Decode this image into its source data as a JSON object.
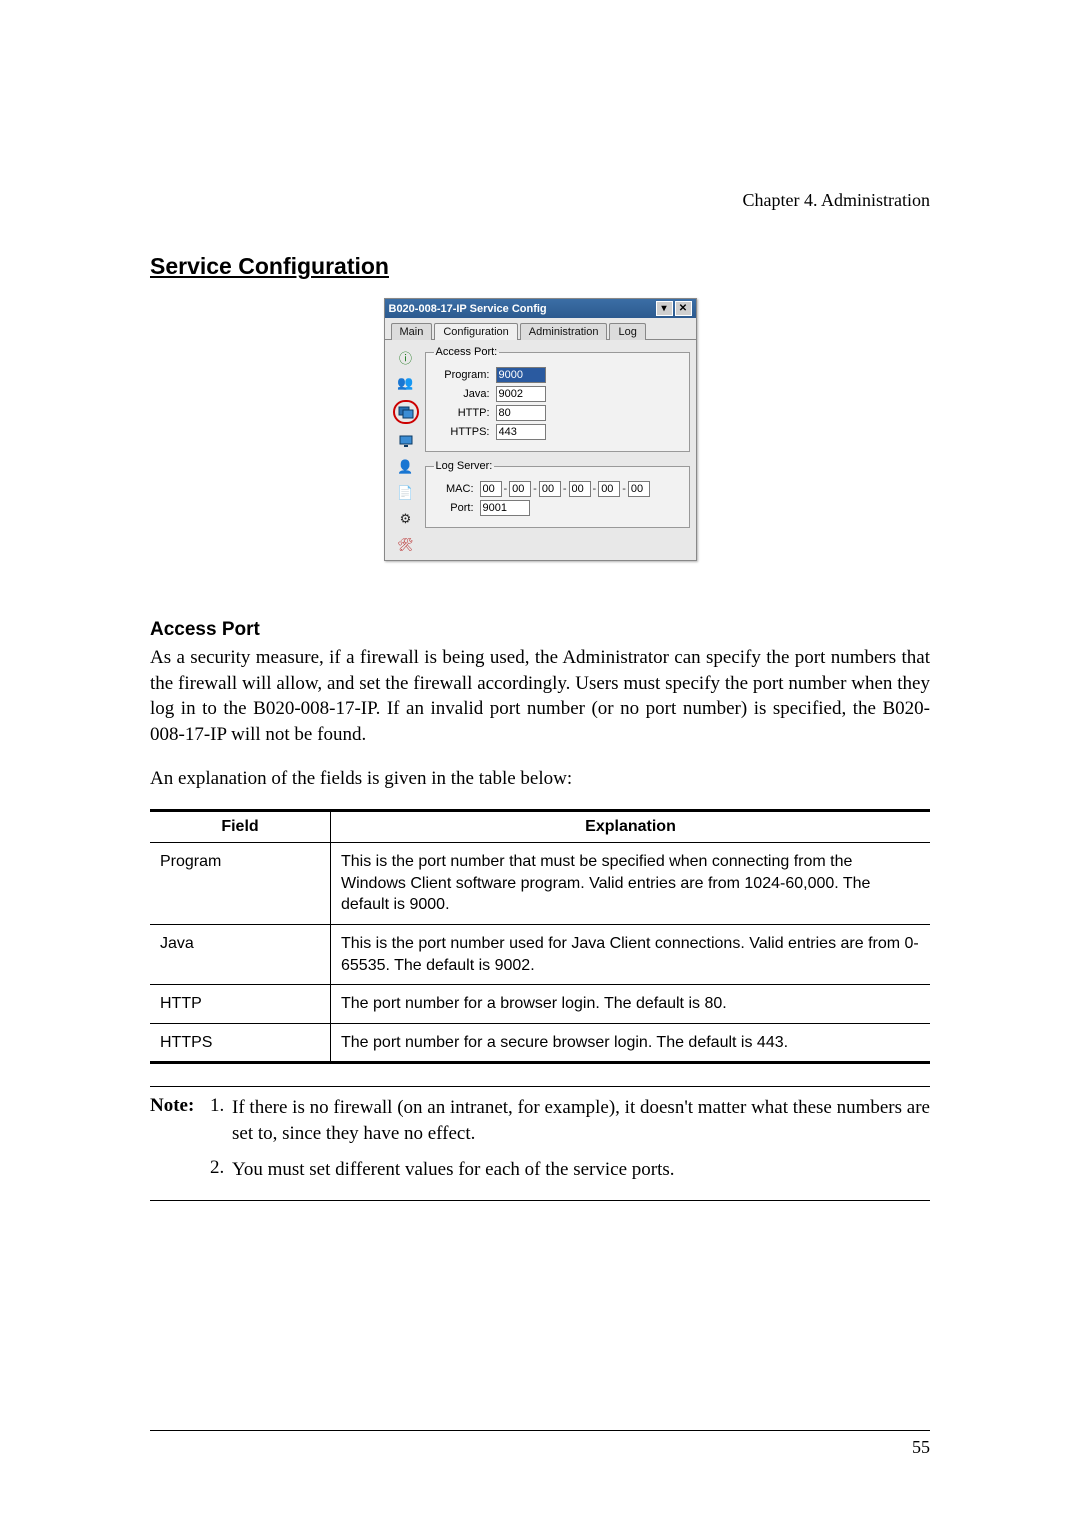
{
  "chapter_header": "Chapter 4. Administration",
  "section_title": "Service Configuration",
  "dialog": {
    "title": "B020-008-17-IP Service Config",
    "tabs": [
      "Main",
      "Configuration",
      "Administration",
      "Log"
    ],
    "active_tab_index": 1,
    "access_port": {
      "legend": "Access Port:",
      "program_label": "Program:",
      "program_value": "9000",
      "java_label": "Java:",
      "java_value": "9002",
      "http_label": "HTTP:",
      "http_value": "80",
      "https_label": "HTTPS:",
      "https_value": "443"
    },
    "log_server": {
      "legend": "Log Server:",
      "mac_label": "MAC:",
      "mac": [
        "00",
        "00",
        "00",
        "00",
        "00",
        "00"
      ],
      "port_label": "Port:",
      "port_value": "9001"
    }
  },
  "access_port_heading": "Access Port",
  "access_port_para": "As a security measure, if a firewall is being used, the Administrator can specify the port numbers that the firewall will allow, and set the firewall accordingly. Users must specify the port number when they log in to the B020-008-17-IP. If an invalid port number (or no port number) is specified, the B020-008-17-IP will not be found.",
  "table_intro": "An explanation of the fields is given in the table below:",
  "table": {
    "head_field": "Field",
    "head_explanation": "Explanation",
    "rows": [
      {
        "field": "Program",
        "explanation": "This is the port number that must be specified when connecting from the Windows Client software program. Valid entries are from 1024-60,000. The default is 9000."
      },
      {
        "field": "Java",
        "explanation": "This is the port number used for Java Client connections. Valid entries are from 0-65535. The default is 9002."
      },
      {
        "field": "HTTP",
        "explanation": "The port number for a browser login. The default is 80."
      },
      {
        "field": "HTTPS",
        "explanation": "The port number for a secure browser login. The default is 443."
      }
    ]
  },
  "notes": {
    "note_label": "Note:",
    "items": [
      "If there is no firewall (on an intranet, for example), it doesn't matter what these numbers are set to, since they have no effect.",
      "You must set different values for each of the service ports."
    ]
  },
  "page_number": "55"
}
